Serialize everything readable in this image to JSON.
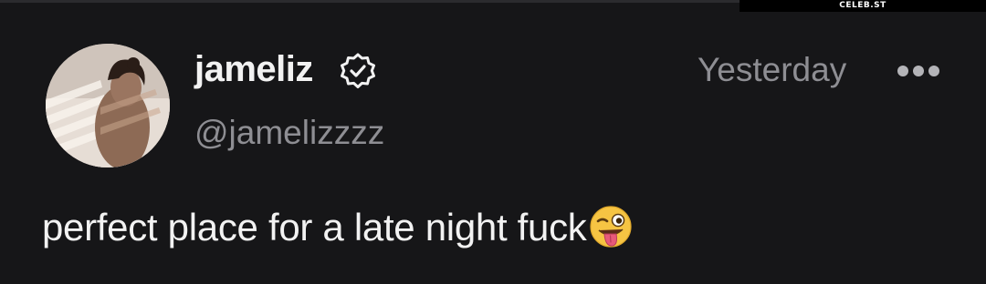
{
  "watermark": {
    "text": "CELEB.ST"
  },
  "author": {
    "display_name": "jameliz",
    "handle": "@jamelizzzz",
    "verified": true
  },
  "post": {
    "timestamp": "Yesterday",
    "text": "perfect place for a late night fuck",
    "emoji": "winking-face-with-tongue"
  },
  "icons": {
    "verified": "verified-badge-icon",
    "more": "more-options-icon"
  },
  "colors": {
    "background": "#161618",
    "primary_text": "#f2f2f2",
    "secondary_text": "#8e8e93",
    "emoji_yellow": "#f6c443",
    "emoji_tongue": "#e85a7a"
  }
}
